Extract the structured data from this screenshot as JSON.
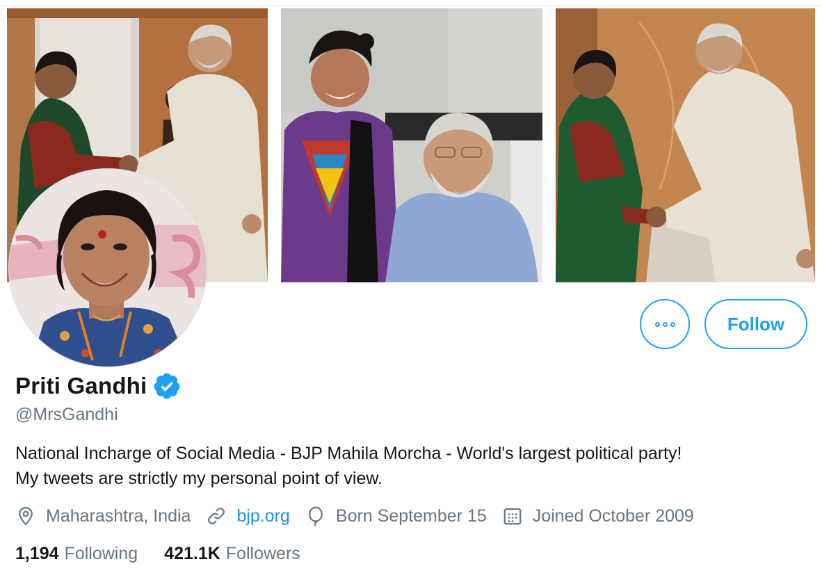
{
  "profile": {
    "display_name": "Priti Gandhi",
    "handle": "@MrsGandhi",
    "verified": true,
    "bio_line_1": "National Incharge of Social Media - BJP Mahila Morcha - World's largest political party!",
    "bio_line_2": "My tweets are strictly my personal point of view."
  },
  "actions": {
    "more_icon": "more-horizontal-icon",
    "follow_label": "Follow"
  },
  "meta": {
    "location": "Maharashtra, India",
    "website": "bjp.org",
    "birthday": "Born September 15",
    "joined": "Joined October 2009"
  },
  "stats": {
    "following_count": "1,194",
    "following_label": "Following",
    "followers_count": "421.1K",
    "followers_label": "Followers"
  },
  "icons": {
    "location": "location-pin-icon",
    "website": "link-icon",
    "birthday": "balloon-icon",
    "joined": "calendar-icon",
    "verified": "verified-badge-icon"
  },
  "colors": {
    "accent": "#1da1f2",
    "link": "#1b95e0",
    "text_primary": "#14171a",
    "text_secondary": "#657786"
  }
}
